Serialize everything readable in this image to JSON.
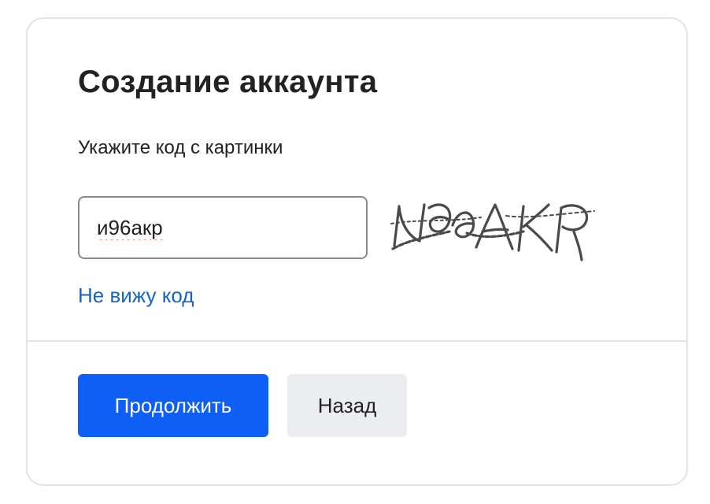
{
  "form": {
    "title": "Создание аккаунта",
    "prompt": "Укажите код с картинки",
    "code_input_value": "и96акр",
    "captcha_image_text": "И96АКР",
    "no_code_link": "Не вижу код"
  },
  "actions": {
    "continue_label": "Продолжить",
    "back_label": "Назад"
  },
  "colors": {
    "primary": "#0e5ff5",
    "link": "#1565c0",
    "secondary_bg": "#ebedf0",
    "border": "#e1e3e6",
    "input_border": "#858a8f",
    "spellcheck_underline": "#e53935"
  }
}
